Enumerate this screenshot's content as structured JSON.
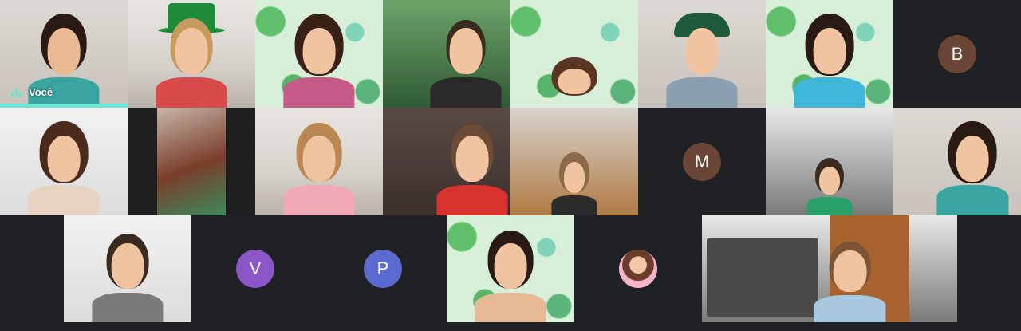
{
  "self_label": "Você",
  "avatars": [
    {
      "letter": "B",
      "color": "#6b4637"
    },
    {
      "letter": "M",
      "color": "#6b4637"
    },
    {
      "letter": "V",
      "color": "#8a56c8"
    },
    {
      "letter": "P",
      "color": "#5b6ad0"
    }
  ],
  "accent": "#67e6d4",
  "background": "#202124"
}
